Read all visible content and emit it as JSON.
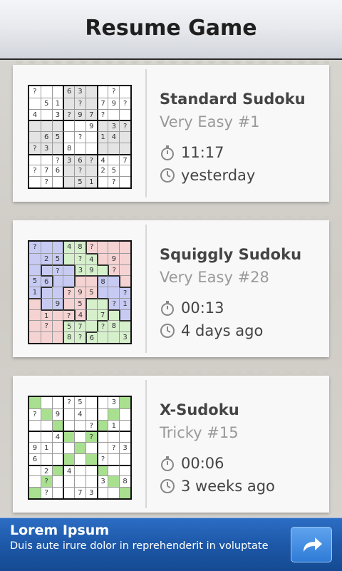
{
  "header": {
    "title": "Resume Game"
  },
  "games": [
    {
      "name": "Standard Sudoku",
      "level": "Very Easy #1",
      "time": "11:17",
      "last_played": "yesterday",
      "style": "standard",
      "grid": [
        [
          "?",
          "",
          "",
          "6",
          "3",
          "",
          "",
          "?",
          ""
        ],
        [
          "",
          "5",
          "1",
          "",
          "?",
          "",
          "7",
          "9",
          "?"
        ],
        [
          "4",
          "",
          "3",
          "?",
          "9",
          "7",
          "?",
          "",
          ""
        ],
        [
          "",
          "",
          "",
          "",
          "",
          "9",
          "",
          "3",
          "?"
        ],
        [
          "",
          "6",
          "5",
          "",
          "?",
          "",
          "1",
          "4",
          ""
        ],
        [
          "?",
          "3",
          "",
          "8",
          "",
          "",
          "",
          "",
          ""
        ],
        [
          "",
          "",
          "?",
          "3",
          "6",
          "?",
          "4",
          "",
          "7"
        ],
        [
          "?",
          "7",
          "6",
          "",
          "?",
          "",
          "2",
          "5",
          ""
        ],
        [
          "",
          "?",
          "",
          "",
          "5",
          "1",
          "",
          "?",
          ""
        ]
      ]
    },
    {
      "name": "Squiggly Sudoku",
      "level": "Very Easy #28",
      "time": "00:13",
      "last_played": "4 days ago",
      "style": "squiggly",
      "grid": [
        [
          "?",
          "",
          "",
          "4",
          "8",
          "?",
          "",
          "",
          ""
        ],
        [
          "",
          "2",
          "5",
          "",
          "?",
          "4",
          "",
          "9",
          ""
        ],
        [
          "",
          "",
          "?",
          "",
          "3",
          "9",
          "",
          "?",
          ""
        ],
        [
          "5",
          "6",
          "",
          "",
          "",
          "",
          "8",
          "",
          ""
        ],
        [
          "1",
          "",
          "",
          "?",
          "9",
          "5",
          "",
          "",
          "?"
        ],
        [
          "",
          "",
          "9",
          "",
          "5",
          "",
          "",
          "?",
          "1"
        ],
        [
          "",
          "1",
          "",
          "?",
          "4",
          "",
          "7",
          "",
          ""
        ],
        [
          "",
          "?",
          "",
          "5",
          "7",
          "",
          "?",
          "8",
          ""
        ],
        [
          "",
          "",
          "",
          "8",
          "?",
          "6",
          "",
          "",
          "3"
        ]
      ],
      "regions": [
        [
          0,
          0,
          0,
          1,
          1,
          2,
          2,
          2,
          2
        ],
        [
          0,
          0,
          0,
          1,
          1,
          1,
          2,
          2,
          2
        ],
        [
          0,
          3,
          3,
          3,
          1,
          1,
          1,
          2,
          2
        ],
        [
          0,
          0,
          3,
          3,
          4,
          4,
          5,
          5,
          2
        ],
        [
          0,
          3,
          3,
          4,
          4,
          4,
          5,
          5,
          5
        ],
        [
          6,
          3,
          3,
          4,
          4,
          7,
          7,
          5,
          5
        ],
        [
          6,
          6,
          6,
          6,
          4,
          7,
          7,
          8,
          5
        ],
        [
          6,
          6,
          6,
          7,
          7,
          7,
          8,
          8,
          8
        ],
        [
          6,
          6,
          6,
          7,
          7,
          8,
          8,
          8,
          8
        ]
      ],
      "region_colors": [
        "#c7cbf3",
        "#d6f0cc",
        "#f6d3d3",
        "#c7cbf3",
        "#f6d3d3",
        "#c7cbf3",
        "#f6d3d3",
        "#d6f0cc",
        "#d6f0cc"
      ]
    },
    {
      "name": "X-Sudoku",
      "level": "Tricky #15",
      "time": "00:06",
      "last_played": "3 weeks ago",
      "style": "x",
      "grid": [
        [
          "",
          "",
          "",
          "?",
          "5",
          "",
          "",
          "3",
          ""
        ],
        [
          "?",
          "",
          "9",
          "",
          "4",
          "",
          "",
          "",
          ""
        ],
        [
          "",
          "",
          "",
          "",
          "",
          "?",
          "",
          "1",
          ""
        ],
        [
          "",
          "",
          "4",
          "",
          "",
          "?",
          "",
          "",
          ""
        ],
        [
          "9",
          "1",
          "",
          "",
          "",
          "",
          "",
          "?",
          "3"
        ],
        [
          "6",
          "",
          "",
          "",
          "",
          "",
          "?",
          "",
          ""
        ],
        [
          "",
          "2",
          "",
          "4",
          "",
          "",
          "",
          "",
          ""
        ],
        [
          "",
          "?",
          "",
          "",
          "",
          "",
          "3",
          "",
          "8"
        ],
        [
          "",
          "?",
          "",
          "",
          "7",
          "3",
          "",
          "",
          ""
        ]
      ],
      "diag_color": "#a8e08f"
    }
  ],
  "ad": {
    "title": "Lorem Ipsum",
    "text": "Duis aute irure dolor in reprehenderit in voluptate"
  },
  "icons": {
    "timer": "stopwatch-icon",
    "clock": "clock-icon",
    "ad_arrow": "share-arrow-icon"
  }
}
